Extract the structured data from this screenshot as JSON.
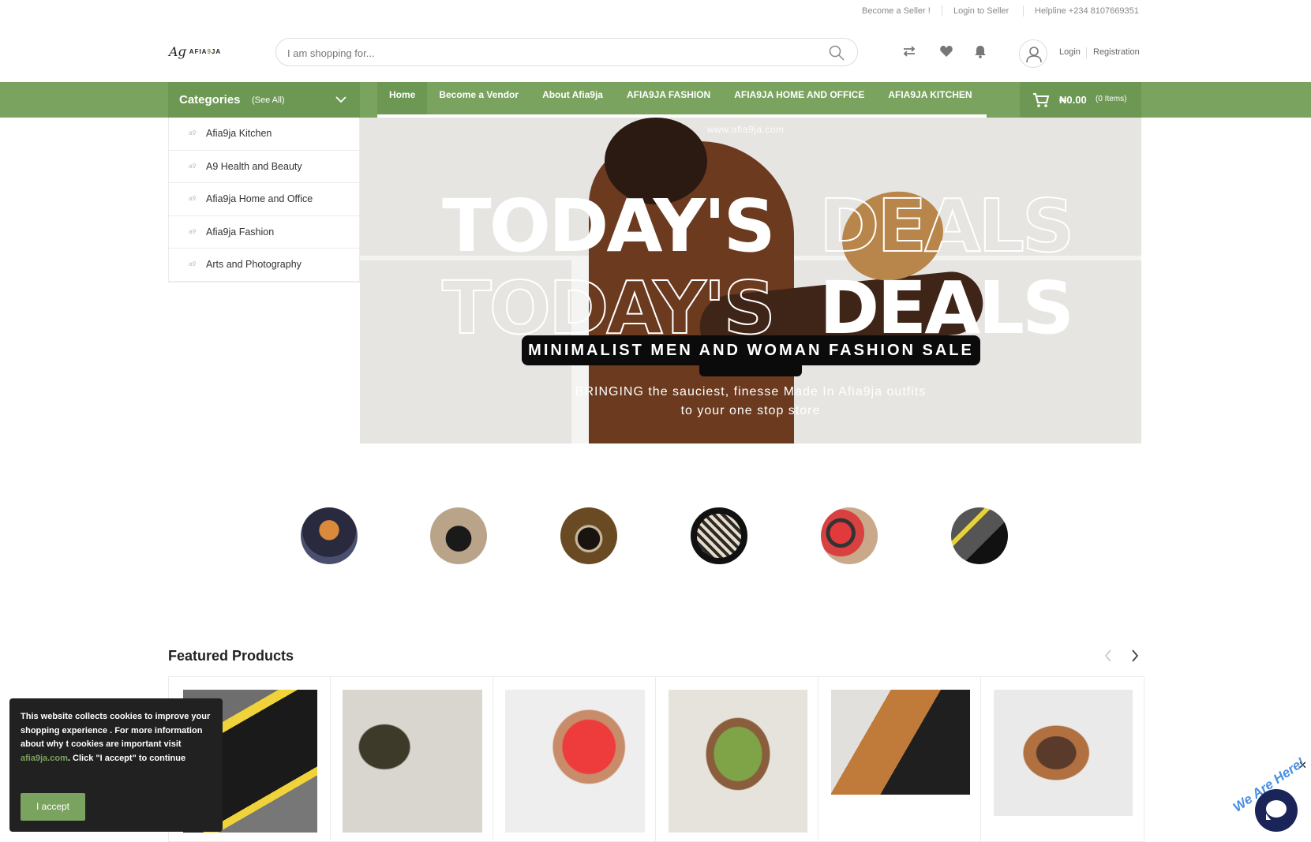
{
  "topbar": {
    "become_seller": "Become a Seller !",
    "login_seller": "Login to Seller",
    "helpline": "Helpline +234 8107669351"
  },
  "header": {
    "logo_mark": "Aɡ",
    "logo_word_a": "AFIA",
    "logo_word_b": "9",
    "logo_word_c": "JA",
    "search_placeholder": "I am shopping for...",
    "login": "Login",
    "registration": "Registration"
  },
  "nav": {
    "categories_title": "Categories",
    "see_all": "(See All)",
    "menu": [
      {
        "label": "Home",
        "active": true
      },
      {
        "label": "Become a Vendor",
        "active": false
      },
      {
        "label": "About Afia9ja",
        "active": false
      },
      {
        "label": "AFIA9JA FASHION",
        "active": false
      },
      {
        "label": "AFIA9JA HOME AND OFFICE",
        "active": false
      },
      {
        "label": "AFIA9JA KITCHEN",
        "active": false
      }
    ],
    "cart_amount": "₦0.00",
    "cart_count": "(0 Items)"
  },
  "categories": [
    "Afia9ja Kitchen",
    "A9 Health and Beauty",
    "Afia9ja Home and Office",
    "Afia9ja Fashion",
    "Arts and Photography"
  ],
  "hero": {
    "watermark": "www.afia9ja.com",
    "word_today": "TODAY'S",
    "word_deals": "DEALS",
    "pill_text": "MINIMALIST MEN AND WOMAN FASHION SALE",
    "sub_line1": "BRINGING the sauciest, finesse Made In Afia9ja outfits",
    "sub_line2": "to your one stop store"
  },
  "featured": {
    "title": "Featured Products"
  },
  "cookie": {
    "text_before": "This website collects cookies to improve your shopping experience . For more information about why t cookies are important visit ",
    "link": "afia9ja.com",
    "text_after": ". Click \"I accept\" to continue",
    "button": "I accept"
  },
  "chat": {
    "label": "We Are Here!",
    "close": "✕"
  },
  "colors": {
    "brand_green": "#7aa35f",
    "brand_green_dark": "#6d9853",
    "cookie_bg": "#212121",
    "chat_navy": "#1a2458"
  }
}
